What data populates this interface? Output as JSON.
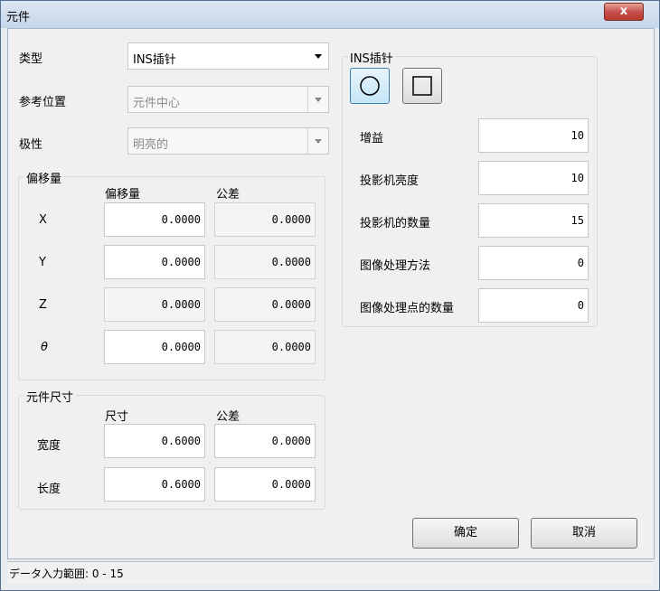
{
  "window": {
    "title": "元件",
    "close_glyph": "x"
  },
  "left": {
    "type_label": "类型",
    "type_value": "INS插针",
    "ref_label": "参考位置",
    "ref_value": "元件中心",
    "polarity_label": "极性",
    "polarity_value": "明亮的",
    "offset_group": {
      "title": "偏移量",
      "col_value": "偏移量",
      "col_tol": "公差",
      "rows": [
        {
          "label": "X",
          "value": "0.0000",
          "tol": "0.0000"
        },
        {
          "label": "Y",
          "value": "0.0000",
          "tol": "0.0000"
        },
        {
          "label": "Z",
          "value": "0.0000",
          "tol": "0.0000"
        },
        {
          "label": "θ",
          "value": "0.0000",
          "tol": "0.0000"
        }
      ]
    },
    "size_group": {
      "title": "元件尺寸",
      "col_value": "尺寸",
      "col_tol": "公差",
      "rows": [
        {
          "label": "宽度",
          "value": "0.6000",
          "tol": "0.0000"
        },
        {
          "label": "长度",
          "value": "0.6000",
          "tol": "0.0000"
        }
      ]
    }
  },
  "right": {
    "group_title": "INS插针",
    "shape_icons": [
      "circle-icon",
      "square-icon"
    ],
    "fields": [
      {
        "label": "增益",
        "value": "10"
      },
      {
        "label": "投影机亮度",
        "value": "10"
      },
      {
        "label": "投影机的数量",
        "value": "15"
      },
      {
        "label": "图像处理方法",
        "value": "0"
      },
      {
        "label": "图像处理点的数量",
        "value": "0"
      }
    ]
  },
  "buttons": {
    "ok": "确定",
    "cancel": "取消"
  },
  "status": "データ入力範囲: 0 - 15"
}
